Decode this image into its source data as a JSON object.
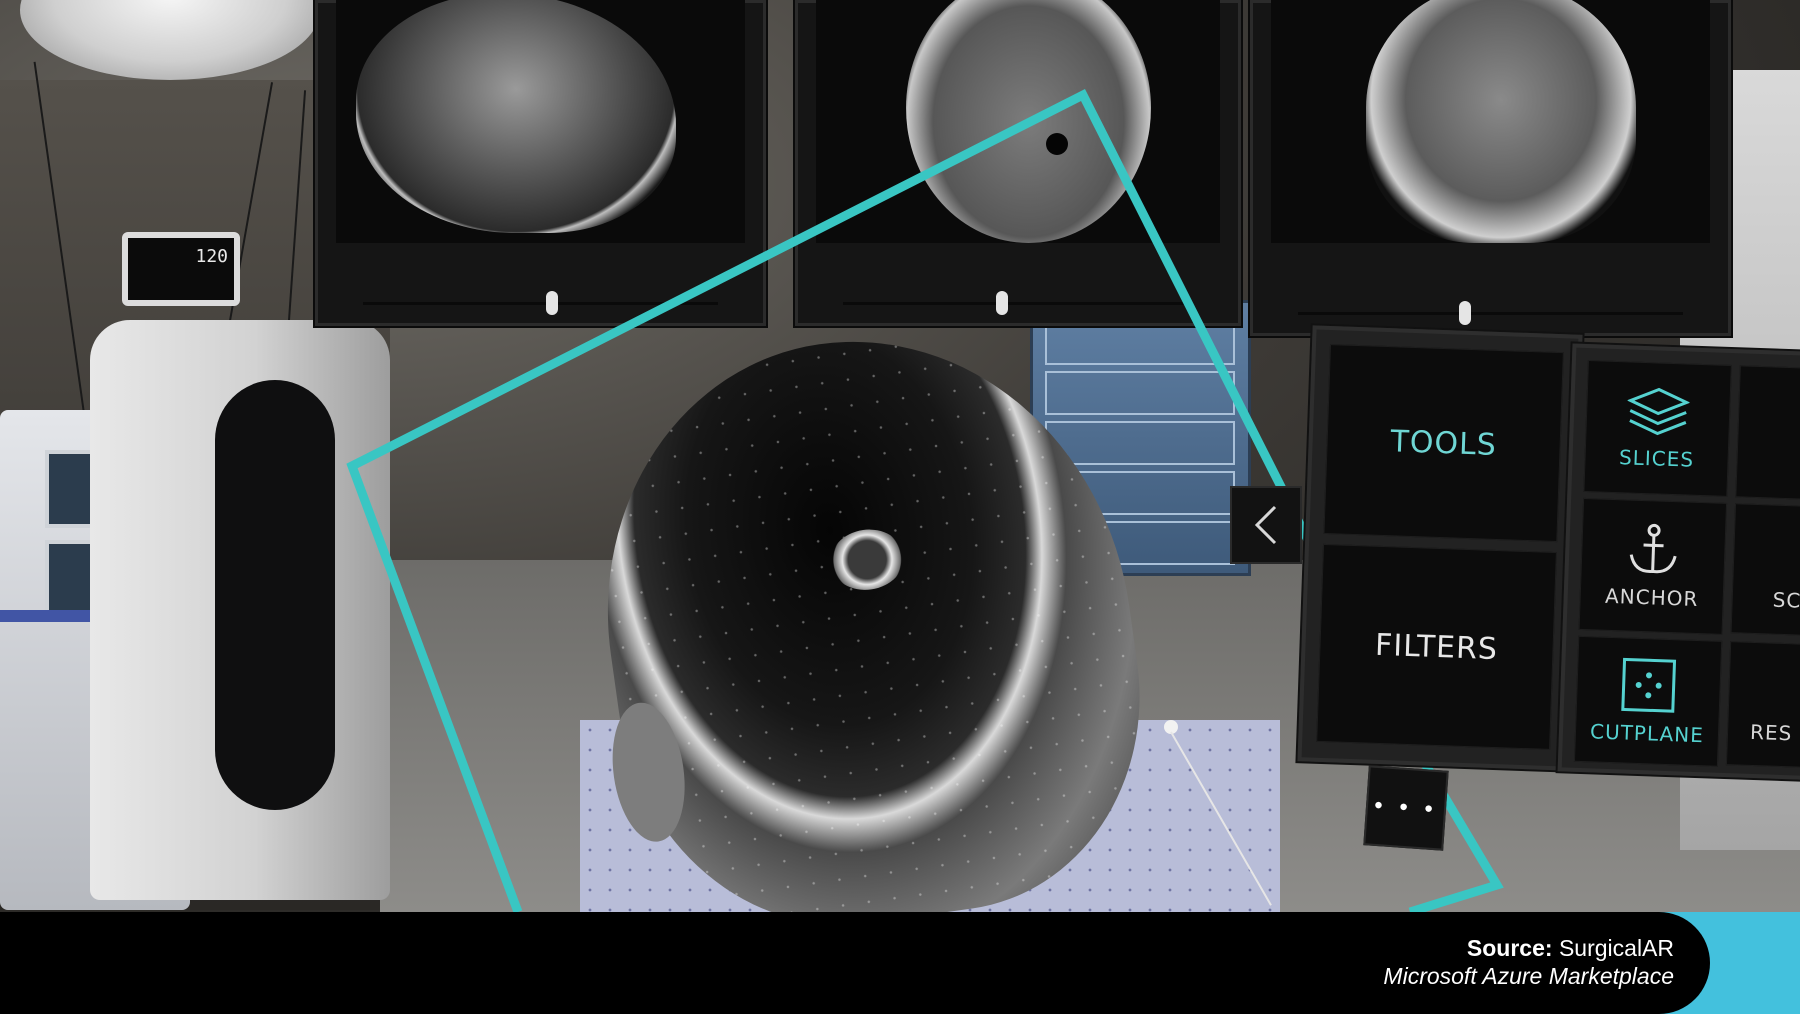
{
  "panels": {
    "menu_left": {
      "tools_label": "TOOLS",
      "filters_label": "FILTERS"
    },
    "menu_right": {
      "items": [
        {
          "label": "SLICES",
          "icon": "layers-icon",
          "active": true
        },
        {
          "label": "ANCHOR",
          "icon": "anchor-icon",
          "active": false
        },
        {
          "label": "CUTPLANE",
          "icon": "cutplane-icon",
          "active": true
        }
      ],
      "partial_labels": [
        "SC",
        "RES"
      ]
    },
    "back_icon": "chevron-left-icon",
    "more_icon": "more-icon",
    "more_label": "• • •"
  },
  "monitor": {
    "reading": "120"
  },
  "footer": {
    "source_label": "Source:",
    "source_value": "SurgicalAR",
    "market": "Microsoft Azure Marketplace"
  },
  "colors": {
    "ar_accent": "#39c6c3",
    "footer_accent": "#43c1dd"
  }
}
